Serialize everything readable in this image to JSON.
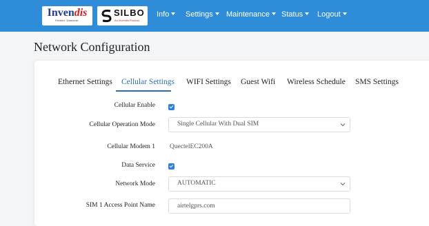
{
  "header": {
    "logo_invendis": {
      "text_main": "Inven",
      "text_accent": "dis",
      "tagline": "Embed. Discover."
    },
    "logo_silbo": {
      "text": "SILBO",
      "tagline": "An Invendis Product"
    },
    "nav": [
      {
        "label": "Info"
      },
      {
        "label": "Settings"
      },
      {
        "label": "Maintenance"
      },
      {
        "label": "Status"
      },
      {
        "label": "Logout"
      }
    ]
  },
  "page": {
    "title": "Network Configuration"
  },
  "tabs": [
    {
      "label": "Ethernet Settings",
      "active": false
    },
    {
      "label": "Cellular Settings",
      "active": true
    },
    {
      "label": "WIFI Settings",
      "active": false
    },
    {
      "label": "Guest Wifi",
      "active": false
    },
    {
      "label": "Wireless Schedule",
      "active": false
    },
    {
      "label": "SMS Settings",
      "active": false
    }
  ],
  "form": {
    "cellular_enable": {
      "label": "Cellular Enable",
      "checked": true
    },
    "operation_mode": {
      "label": "Cellular Operation Mode",
      "value": "Single Cellular With Dual SIM"
    },
    "modem": {
      "label": "Cellular Modem 1",
      "value": "QuectelEC200A"
    },
    "data_service": {
      "label": "Data Service",
      "checked": true
    },
    "network_mode": {
      "label": "Network Mode",
      "value": "AUTOMATIC"
    },
    "sim1_apn": {
      "label": "SIM 1 Access Point Name",
      "value": "airtelgprs.com"
    }
  },
  "colors": {
    "topbar": "#2f8cd8",
    "accent": "#2a6db3",
    "checkbox": "#2f7ee0"
  }
}
